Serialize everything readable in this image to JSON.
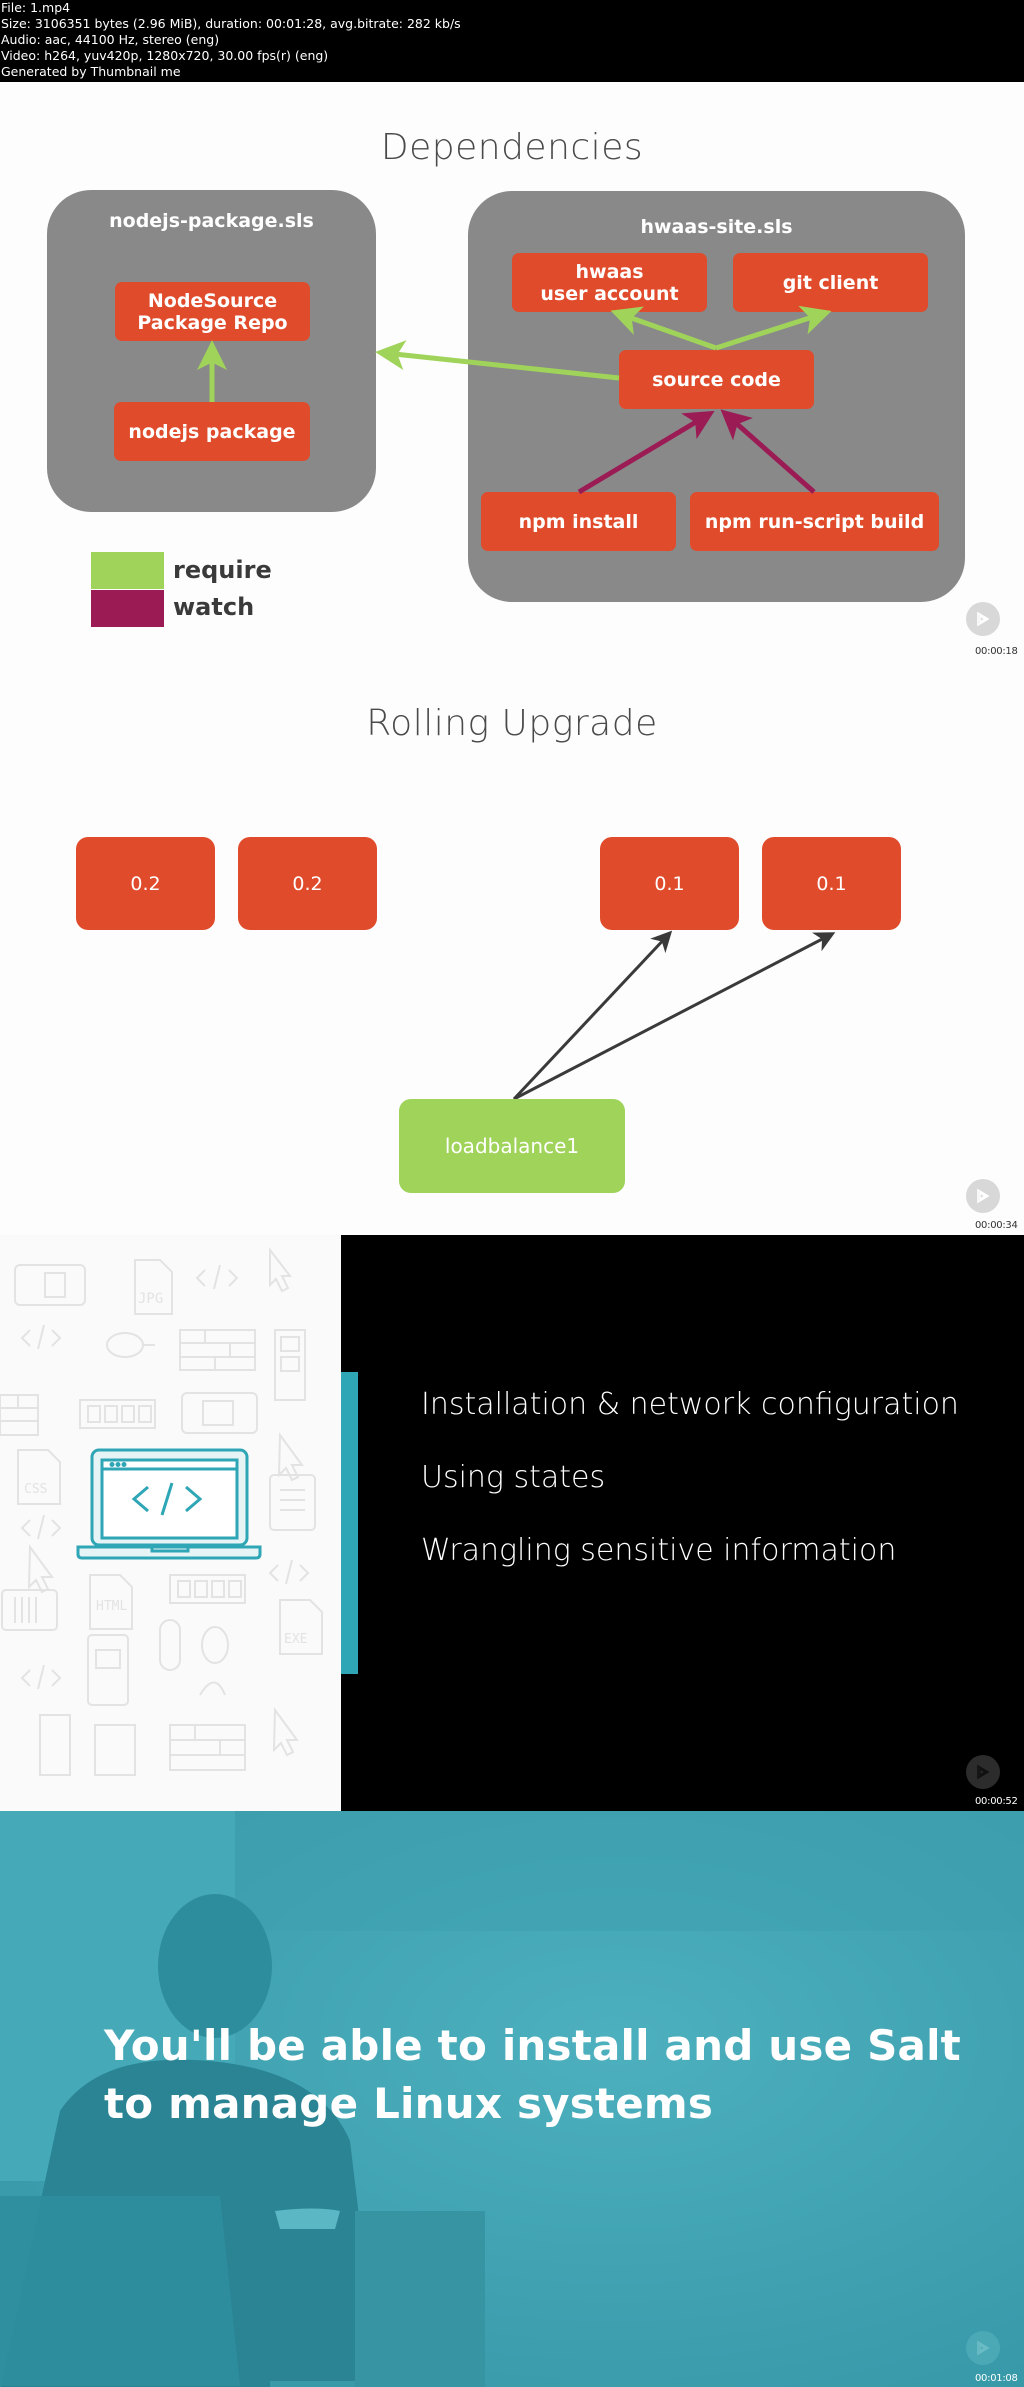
{
  "file_info": {
    "lines": [
      "File: 1.mp4",
      "Size: 3106351 bytes (2.96 MiB), duration: 00:01:28, avg.bitrate: 282 kb/s",
      "Audio: aac, 44100 Hz, stereo (eng)",
      "Video: h264, yuv420p, 1280x720, 30.00 fps(r) (eng)",
      "Generated by Thumbnail me"
    ]
  },
  "colors": {
    "node_orange": "#e04b2b",
    "group_gray": "#898989",
    "require_green": "#9fd35a",
    "watch_purple": "#9b1b55",
    "accent_teal": "#2fa6b6",
    "teal_overlay": "#3fa6b6"
  },
  "frames": [
    {
      "title": "Dependencies",
      "timestamp": "00:00:18",
      "groups": [
        {
          "title": "nodejs-package.sls",
          "nodes": [
            "NodeSource\nPackage Repo",
            "nodejs package"
          ]
        },
        {
          "title": "hwaas-site.sls",
          "nodes": [
            "hwaas\nuser account",
            "git client",
            "source code",
            "npm install",
            "npm run-script build"
          ]
        }
      ],
      "edges": [
        {
          "from": "nodejs package",
          "to": "NodeSource Package Repo",
          "type": "require"
        },
        {
          "from": "source code",
          "to": "nodejs-package.sls",
          "type": "require"
        },
        {
          "from": "source code",
          "to": "hwaas user account",
          "type": "require"
        },
        {
          "from": "source code",
          "to": "git client",
          "type": "require"
        },
        {
          "from": "npm install",
          "to": "source code",
          "type": "watch"
        },
        {
          "from": "npm run-script build",
          "to": "source code",
          "type": "watch"
        }
      ],
      "legend": [
        {
          "label": "require",
          "color": "#9fd35a"
        },
        {
          "label": "watch",
          "color": "#9b1b55"
        }
      ]
    },
    {
      "title": "Rolling Upgrade",
      "timestamp": "00:00:34",
      "servers": [
        "0.2",
        "0.2",
        "0.1",
        "0.1"
      ],
      "load_balancer": "loadbalance1"
    },
    {
      "timestamp": "00:00:52",
      "topics": [
        "Installation & network configuration",
        "Using states",
        "Wrangling sensitive information"
      ]
    },
    {
      "timestamp": "00:01:08",
      "headline": [
        "You'll be able to install and use Salt",
        "to manage Linux systems"
      ]
    }
  ]
}
